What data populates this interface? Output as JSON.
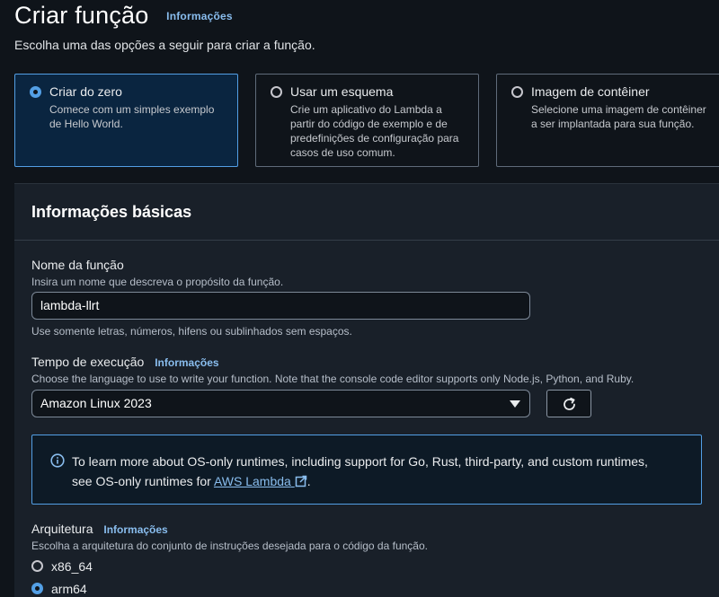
{
  "header": {
    "title": "Criar função",
    "info_link": "Informações",
    "subtitle": "Escolha uma das opções a seguir para criar a função."
  },
  "options": [
    {
      "title": "Criar do zero",
      "desc": "Comece com um simples exemplo de Hello World.",
      "selected": true
    },
    {
      "title": "Usar um esquema",
      "desc": "Crie um aplicativo do Lambda a partir do código de exemplo e de predefinições de configuração para casos de uso comum.",
      "selected": false
    },
    {
      "title": "Imagem de contêiner",
      "desc": "Selecione uma imagem de contêiner a ser implantada para sua função.",
      "selected": false
    }
  ],
  "basic_info": {
    "heading": "Informações básicas",
    "function_name": {
      "label": "Nome da função",
      "description": "Insira um nome que descreva o propósito da função.",
      "value": "lambda-llrt",
      "constraint": "Use somente letras, números, hifens ou sublinhados sem espaços."
    },
    "runtime": {
      "label": "Tempo de execução",
      "info_link": "Informações",
      "description": "Choose the language to use to write your function. Note that the console code editor supports only Node.js, Python, and Ruby.",
      "selected": "Amazon Linux 2023",
      "refresh_icon": "refresh-icon"
    },
    "alert": {
      "icon": "info-icon",
      "text_line1": "To learn more about OS-only runtimes, including support for Go, Rust, third-party, and custom runtimes,",
      "text_line2_prefix": "see OS-only runtimes for ",
      "link_text": "AWS Lambda",
      "text_suffix": ".",
      "external_icon": "external-link-icon"
    },
    "architecture": {
      "label": "Arquitetura",
      "info_link": "Informações",
      "description": "Escolha a arquitetura do conjunto de instruções desejada para o código da função.",
      "options": [
        {
          "label": "x86_64",
          "selected": false
        },
        {
          "label": "arm64",
          "selected": true
        }
      ]
    }
  },
  "colors": {
    "accent": "#539fe5",
    "link": "#89bdee",
    "background": "#0f141a",
    "panel": "#192029"
  }
}
